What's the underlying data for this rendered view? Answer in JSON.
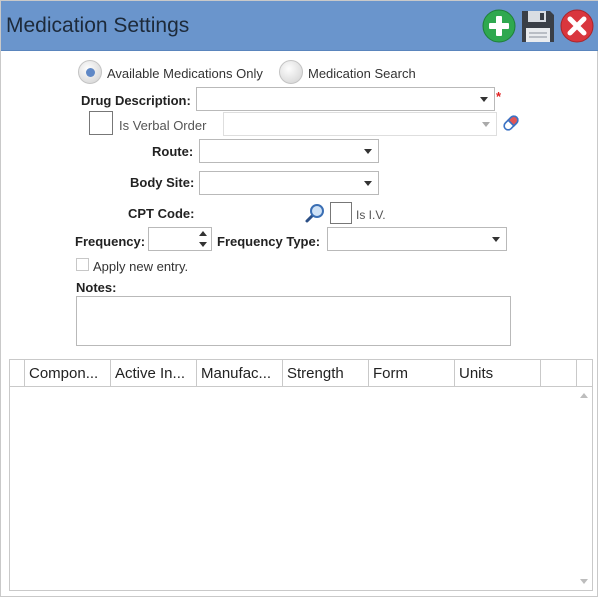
{
  "window": {
    "title": "Medication Settings",
    "buttons": {
      "add": "add-icon",
      "save": "save-icon",
      "close": "close-icon"
    }
  },
  "search_mode": {
    "options": [
      {
        "label": "Available Medications Only",
        "selected": true
      },
      {
        "label": "Medication Search",
        "selected": false
      }
    ]
  },
  "form": {
    "drug_description": {
      "label": "Drug Description:",
      "value": "",
      "required_mark": "*"
    },
    "verbal_order": {
      "label": "Is Verbal Order",
      "checked": false,
      "value": ""
    },
    "route": {
      "label": "Route:",
      "value": ""
    },
    "body_site": {
      "label": "Body Site:",
      "value": ""
    },
    "cpt_code": {
      "label": "CPT Code:",
      "value": ""
    },
    "is_iv": {
      "label": "Is I.V.",
      "checked": false
    },
    "frequency": {
      "label": "Frequency:",
      "value": ""
    },
    "frequency_type": {
      "label": "Frequency Type:",
      "value": ""
    },
    "apply_new_entry": {
      "label": "Apply new entry.",
      "checked": false
    },
    "notes": {
      "label": "Notes:",
      "value": ""
    }
  },
  "grid": {
    "columns": [
      "Compon...",
      "Active In...",
      "Manufac...",
      "Strength",
      "Form",
      "Units"
    ],
    "rows": []
  },
  "colors": {
    "titlebar": "#6a95cc",
    "radio_selected": "#5f88c6",
    "required": "#e02020",
    "add_icon": "#2fa84f",
    "close_icon": "#d9363e",
    "save_icon": "#3a3f47"
  }
}
